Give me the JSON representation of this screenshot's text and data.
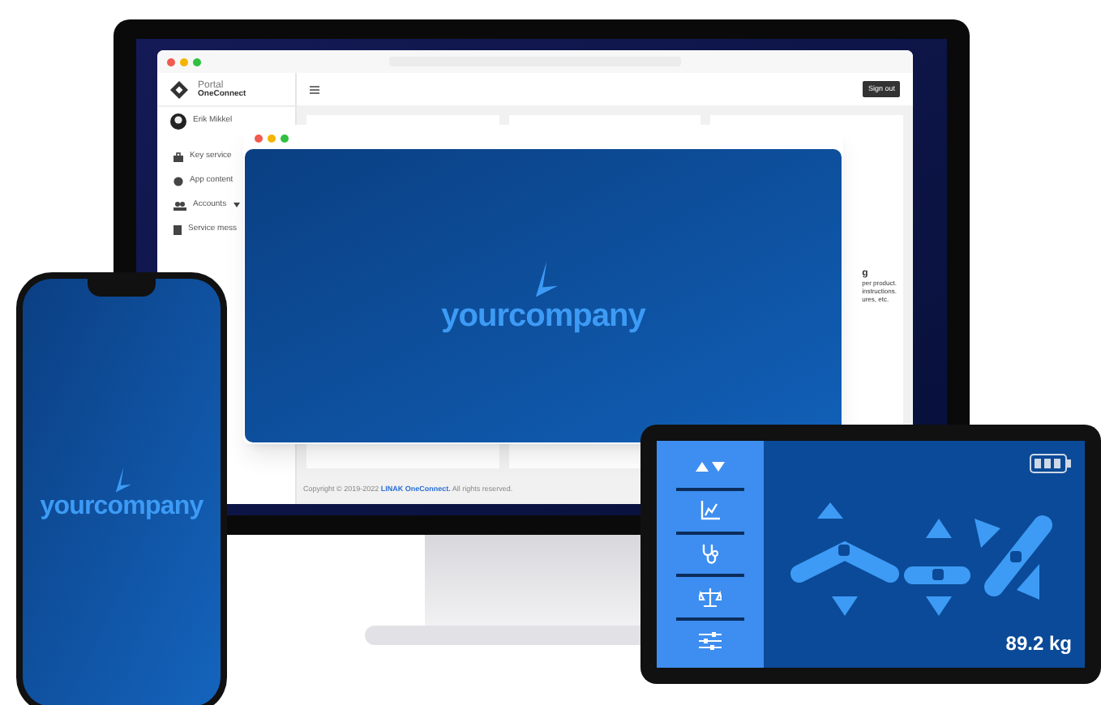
{
  "monitor": {
    "browser": {
      "sidebar": {
        "brand": "Portal",
        "sub_brand": "OneConnect",
        "user": "Erik Mikkel",
        "items": [
          {
            "label": "Key service",
            "kind": "plain"
          },
          {
            "label": "App content",
            "kind": "plain"
          },
          {
            "label": "Accounts",
            "kind": "dropdown"
          },
          {
            "label": "Service mess",
            "kind": "plain"
          }
        ]
      },
      "sign_out": "Sign out",
      "card_lines": [
        "g",
        "per product.",
        "instructions.",
        "ures, etc."
      ],
      "footer": {
        "before": "Copyright © 2019-2022",
        "link": "LINAK OneConnect.",
        "after": "All rights reserved."
      }
    },
    "overlay_window": {
      "logo": "yourcompany"
    }
  },
  "phone": {
    "logo": "yourcompany"
  },
  "tablet": {
    "weight": "89.2 kg"
  }
}
